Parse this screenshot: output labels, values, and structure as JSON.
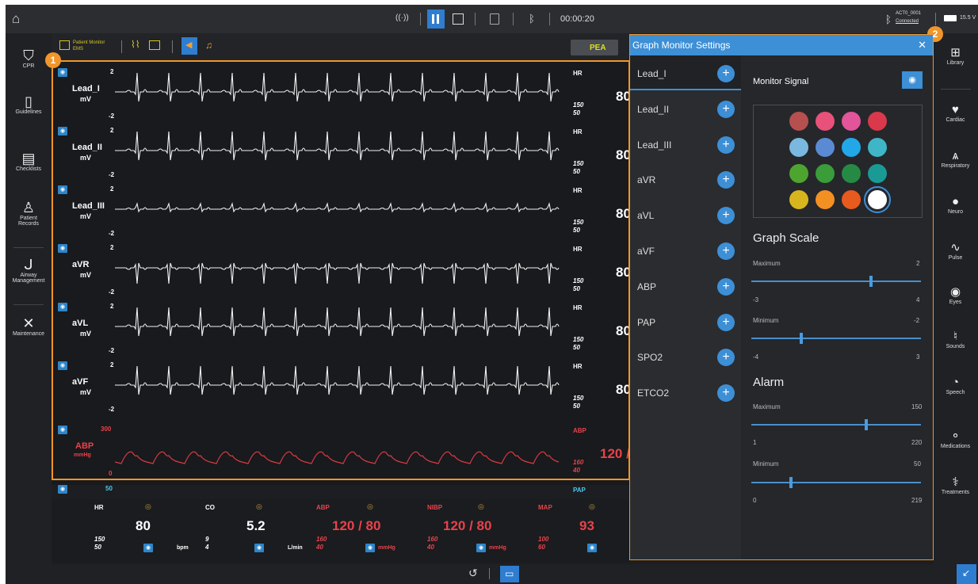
{
  "topbar": {
    "timer": "00:00:20",
    "device_name": "ACT0_0001",
    "device_status": "Connected",
    "battery": "15.5 V"
  },
  "left_nav": [
    {
      "label": "CPR"
    },
    {
      "label": "Guidelines"
    },
    {
      "label": "Checklists"
    },
    {
      "label": "Patient Records"
    },
    {
      "label": "Airway Management"
    },
    {
      "label": "Maintenance"
    }
  ],
  "right_nav": [
    {
      "label": "Library"
    },
    {
      "label": "Cardiac"
    },
    {
      "label": "Respiratory"
    },
    {
      "label": "Neuro"
    },
    {
      "label": "Pulse"
    },
    {
      "label": "Eyes"
    },
    {
      "label": "Sounds"
    },
    {
      "label": "Speech"
    },
    {
      "label": "Medications"
    },
    {
      "label": "Treatments"
    }
  ],
  "monitor": {
    "mode_line1": "Patient Monitor",
    "mode_line2": "EMS",
    "rhythm": "PEA",
    "callout1": "1",
    "callout2": "2",
    "channels": [
      {
        "name": "Lead_I",
        "unit": "mV",
        "max": "2",
        "min": "-2",
        "param": "HR",
        "hi": "150",
        "lo": "50",
        "value": "80"
      },
      {
        "name": "Lead_II",
        "unit": "mV",
        "max": "2",
        "min": "-2",
        "param": "HR",
        "hi": "150",
        "lo": "50",
        "value": "80"
      },
      {
        "name": "Lead_III",
        "unit": "mV",
        "max": "2",
        "min": "-2",
        "param": "HR",
        "hi": "150",
        "lo": "50",
        "value": "80"
      },
      {
        "name": "aVR",
        "unit": "mV",
        "max": "2",
        "min": "-2",
        "param": "HR",
        "hi": "150",
        "lo": "50",
        "value": "80"
      },
      {
        "name": "aVL",
        "unit": "mV",
        "max": "2",
        "min": "-2",
        "param": "HR",
        "hi": "150",
        "lo": "50",
        "value": "80"
      },
      {
        "name": "aVF",
        "unit": "mV",
        "max": "2",
        "min": "-2",
        "param": "HR",
        "hi": "150",
        "lo": "50",
        "value": "80"
      }
    ],
    "abp": {
      "name": "ABP",
      "unit": "mmHg",
      "max": "300",
      "min": "0",
      "param": "ABP",
      "hi": "160",
      "lo": "40",
      "value": "120 /"
    },
    "pap": {
      "max": "50",
      "param": "PAP"
    }
  },
  "vitals": [
    {
      "label": "HR",
      "value": "80",
      "unit": "bpm",
      "hi": "150",
      "lo": "50"
    },
    {
      "label": "CO",
      "value": "5.2",
      "unit": "L/min",
      "hi": "9",
      "lo": "4"
    },
    {
      "label": "ABP",
      "value": "120 / 80",
      "unit": "mmHg",
      "hi": "160",
      "lo": "40"
    },
    {
      "label": "NIBP",
      "value": "120 / 80",
      "unit": "mmHg",
      "hi": "160",
      "lo": "40"
    },
    {
      "label": "MAP",
      "value": "93",
      "unit": "",
      "hi": "100",
      "lo": "60"
    }
  ],
  "settings": {
    "title": "Graph Monitor Settings",
    "signals": [
      "Lead_I",
      "Lead_II",
      "Lead_III",
      "aVR",
      "aVL",
      "aVF",
      "ABP",
      "PAP",
      "SPO2",
      "ETCO2"
    ],
    "monitor_signal_label": "Monitor Signal",
    "colors": [
      "#b5504e",
      "#e8517a",
      "#e2559a",
      "#d9394a",
      "#7ab8e0",
      "#5a8ad4",
      "#22a8e8",
      "#3fb6c8",
      "#4da52f",
      "#3a9d3a",
      "#268a44",
      "#1a9a94",
      "#d8b51e",
      "#f39022",
      "#e85a1e",
      "#ffffff"
    ],
    "graph_scale_title": "Graph Scale",
    "scale_max": {
      "label": "Maximum",
      "value": "2",
      "range_min": "-3",
      "range_max": "4",
      "fraction": 0.71
    },
    "scale_min": {
      "label": "Minimum",
      "value": "-2",
      "range_min": "-4",
      "range_max": "3",
      "fraction": 0.29
    },
    "alarm_title": "Alarm",
    "alarm_max": {
      "label": "Maximum",
      "value": "150",
      "range_min": "1",
      "range_max": "220",
      "fraction": 0.68
    },
    "alarm_min": {
      "label": "Minimum",
      "value": "50",
      "range_min": "0",
      "range_max": "219",
      "fraction": 0.23
    }
  }
}
